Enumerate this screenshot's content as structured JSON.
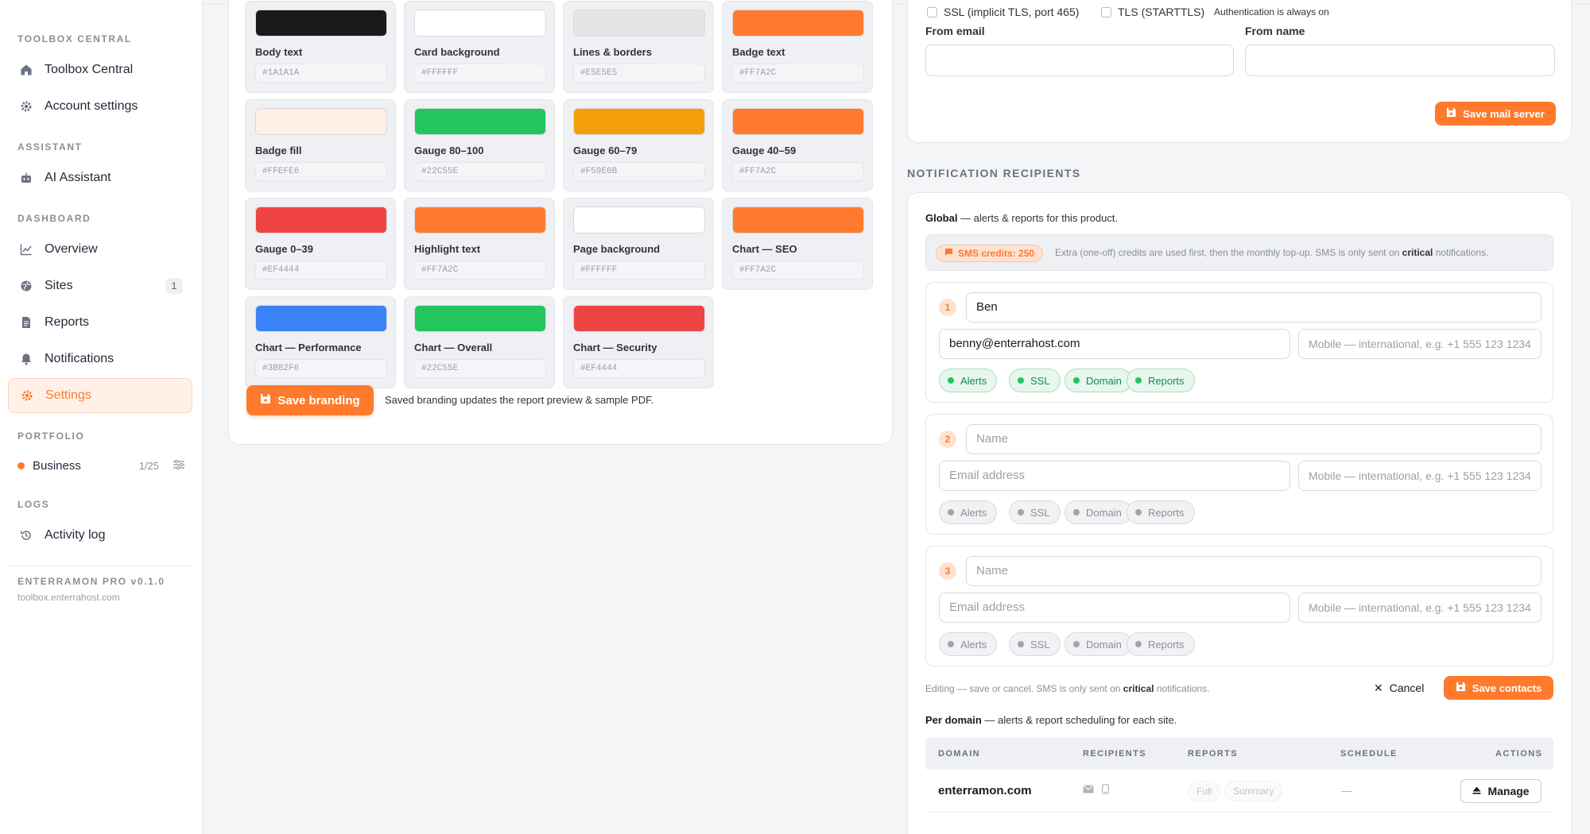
{
  "sidebar": {
    "sections": {
      "toolbox": "TOOLBOX CENTRAL",
      "assistant": "ASSISTANT",
      "dashboard": "DASHBOARD",
      "portfolio": "PORTFOLIO",
      "logs": "LOGS"
    },
    "items": {
      "toolbox_central": "Toolbox Central",
      "account_settings": "Account settings",
      "ai_assistant": "AI Assistant",
      "overview": "Overview",
      "sites": "Sites",
      "sites_count": "1",
      "reports": "Reports",
      "notifications": "Notifications",
      "settings": "Settings",
      "activity_log": "Activity log"
    },
    "portfolio": {
      "name": "Business",
      "count": "1/25"
    },
    "version": "ENTERRAMON PRO v0.1.0",
    "host": "toolbox.enterrahost.com"
  },
  "branding": {
    "swatches": [
      {
        "label": "Body text",
        "hex": "#1A1A1A",
        "color": "#1A1A1A"
      },
      {
        "label": "Card background",
        "hex": "#FFFFFF",
        "color": "#FFFFFF"
      },
      {
        "label": "Lines & borders",
        "hex": "#E5E5E5",
        "color": "#E5E5E5"
      },
      {
        "label": "Badge text",
        "hex": "#FF7A2C",
        "color": "#FF7A2C"
      },
      {
        "label": "Badge fill",
        "hex": "#FFEFE6",
        "color": "#FFEFE6"
      },
      {
        "label": "Gauge 80–100",
        "hex": "#22C55E",
        "color": "#22C55E"
      },
      {
        "label": "Gauge 60–79",
        "hex": "#F59E0B",
        "color": "#F59E0B"
      },
      {
        "label": "Gauge 40–59",
        "hex": "#FF7A2C",
        "color": "#FF7A2C"
      },
      {
        "label": "Gauge 0–39",
        "hex": "#EF4444",
        "color": "#EF4444"
      },
      {
        "label": "Highlight text",
        "hex": "#FF7A2C",
        "color": "#FF7A2C"
      },
      {
        "label": "Page background",
        "hex": "#FFFFFF",
        "color": "#FFFFFF"
      },
      {
        "label": "Chart — SEO",
        "hex": "#FF7A2C",
        "color": "#FF7A2C"
      },
      {
        "label": "Chart — Performance",
        "hex": "#3B82F6",
        "color": "#3B82F6"
      },
      {
        "label": "Chart — Overall",
        "hex": "#22C55E",
        "color": "#22C55E"
      },
      {
        "label": "Chart — Security",
        "hex": "#EF4444",
        "color": "#EF4444"
      }
    ],
    "save_label": "Save branding",
    "save_note": "Saved branding updates the report preview & sample PDF."
  },
  "mail": {
    "ssl_label": "SSL (implicit TLS, port 465)",
    "tls_label": "TLS (STARTTLS)",
    "auth_note": "Authentication is always on",
    "from_email_label": "From email",
    "from_email_value": "",
    "from_name_label": "From name",
    "from_name_value": "",
    "save_label": "Save mail server"
  },
  "notifications": {
    "section_title": "NOTIFICATION RECIPIENTS",
    "global_title": "Global",
    "global_desc": " — alerts & reports for this product.",
    "sms_credits": "SMS credits: 250",
    "sms_text_a": "Extra (one-off) credits are used first, then the monthly top-up. SMS is only sent on ",
    "sms_text_b": "critical",
    "sms_text_c": " notifications.",
    "contacts": [
      {
        "num": "1",
        "name": "Ben",
        "email": "benny@enterrahost.com",
        "mobile": ""
      },
      {
        "num": "2",
        "name": "",
        "email": "",
        "mobile": ""
      },
      {
        "num": "3",
        "name": "",
        "email": "",
        "mobile": ""
      }
    ],
    "placeholders": {
      "name": "Name",
      "email": "Email address",
      "mobile": "Mobile — international, e.g. +1 555 123 1234"
    },
    "chips": [
      "Alerts",
      "SSL",
      "Domain",
      "Reports"
    ],
    "edit_note_a": "Editing — save or cancel. SMS is only sent on ",
    "edit_note_b": "critical",
    "edit_note_c": " notifications.",
    "cancel_label": "Cancel",
    "save_label": "Save contacts",
    "perdomain_title": "Per domain",
    "perdomain_desc": " — alerts & report scheduling for each site.",
    "table_headers": [
      "DOMAIN",
      "RECIPIENTS",
      "REPORTS",
      "SCHEDULE",
      "ACTIONS"
    ],
    "row": {
      "domain": "enterramon.com",
      "report_full": "Full",
      "report_summary": "Summary",
      "schedule": "—",
      "action": "Manage"
    }
  },
  "colors": {
    "accent": "#FF7A2C",
    "success": "#22C55E"
  }
}
